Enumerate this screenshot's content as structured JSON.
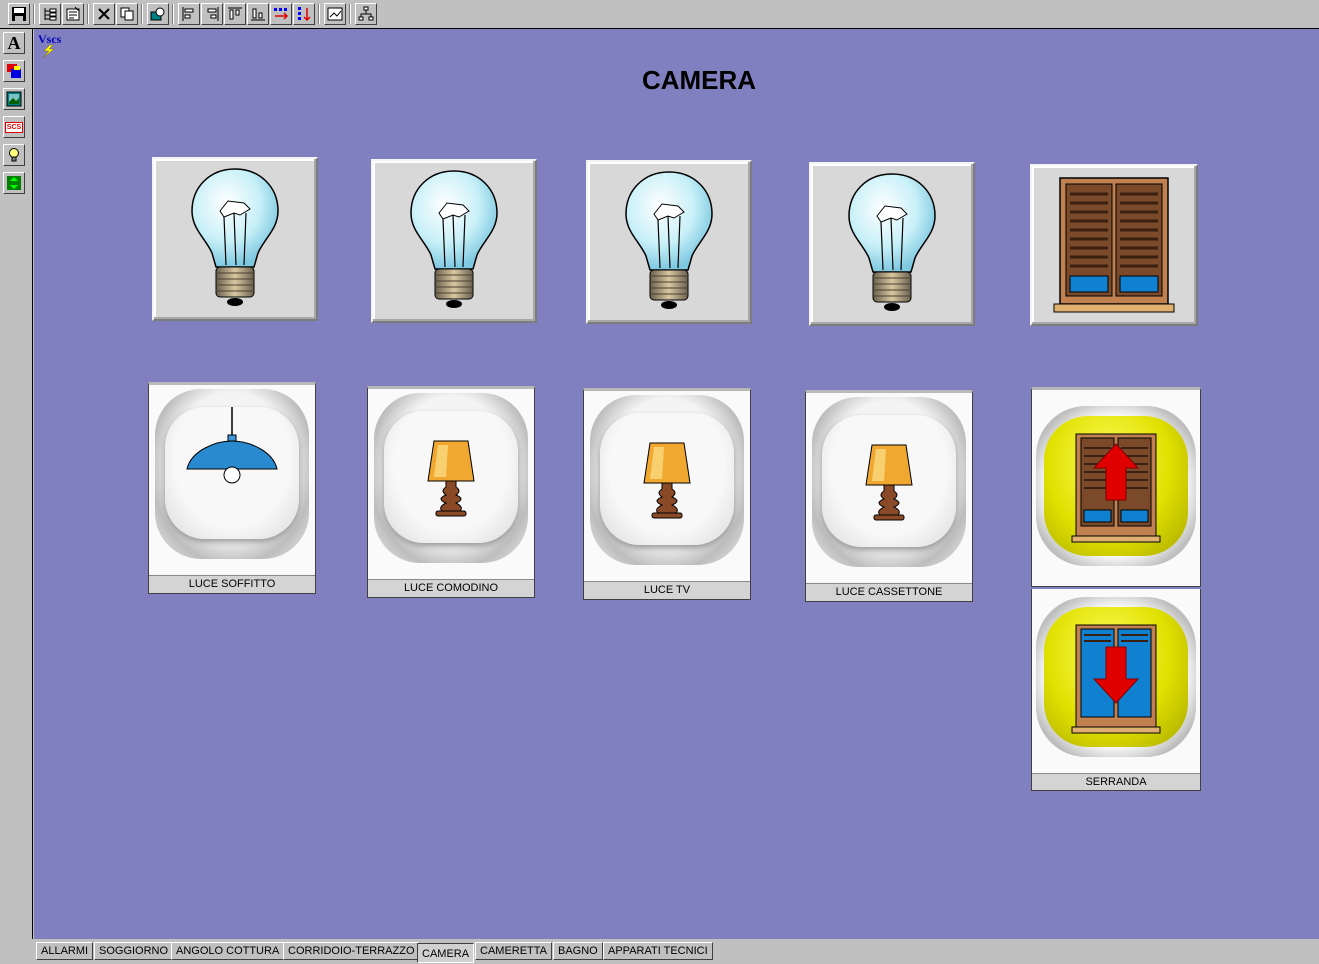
{
  "page": {
    "title": "CAMERA",
    "logo_text": "Vscs"
  },
  "toolbar": {
    "icons": [
      "save-icon",
      "tree-icon",
      "properties-icon",
      "delete-icon",
      "copy-icon",
      "zoom-icon",
      "align-left-icon",
      "align-right-icon",
      "align-top-icon",
      "align-bottom-icon",
      "distribute-horizontal-icon",
      "distribute-vertical-icon",
      "chart-icon",
      "network-icon"
    ]
  },
  "sidebar": {
    "icons": [
      "text-tool-icon",
      "color-tool-icon",
      "image-tool-icon",
      "scs-tool-icon",
      "bulb-tool-icon",
      "arrows-tool-icon"
    ],
    "text_glyph": "A",
    "scs_glyph": "SCS"
  },
  "lights": [
    {
      "label": "LUCE SOFFITTO",
      "icon": "ceiling-lamp-icon"
    },
    {
      "label": "LUCE COMODINO",
      "icon": "table-lamp-icon"
    },
    {
      "label": "LUCE TV",
      "icon": "table-lamp-icon"
    },
    {
      "label": "LUCE CASSETTONE",
      "icon": "table-lamp-icon"
    }
  ],
  "shutter": {
    "label": "SERRANDA",
    "up_icon": "shutter-up-icon",
    "down_icon": "shutter-down-icon"
  },
  "tabs": [
    {
      "label": "ALLARMI",
      "active": false
    },
    {
      "label": "SOGGIORNO",
      "active": false
    },
    {
      "label": "ANGOLO COTTURA",
      "active": false
    },
    {
      "label": "CORRIDOIO-TERRAZZO",
      "active": false
    },
    {
      "label": "CAMERA",
      "active": true
    },
    {
      "label": "CAMERETTA",
      "active": false
    },
    {
      "label": "BAGNO",
      "active": false
    },
    {
      "label": "APPARATI TECNICI",
      "active": false
    }
  ],
  "colors": {
    "canvas": "#8080c0",
    "chrome": "#c0c0c0",
    "accent_yellow": "#e0e000",
    "arrow_red": "#e00000"
  }
}
